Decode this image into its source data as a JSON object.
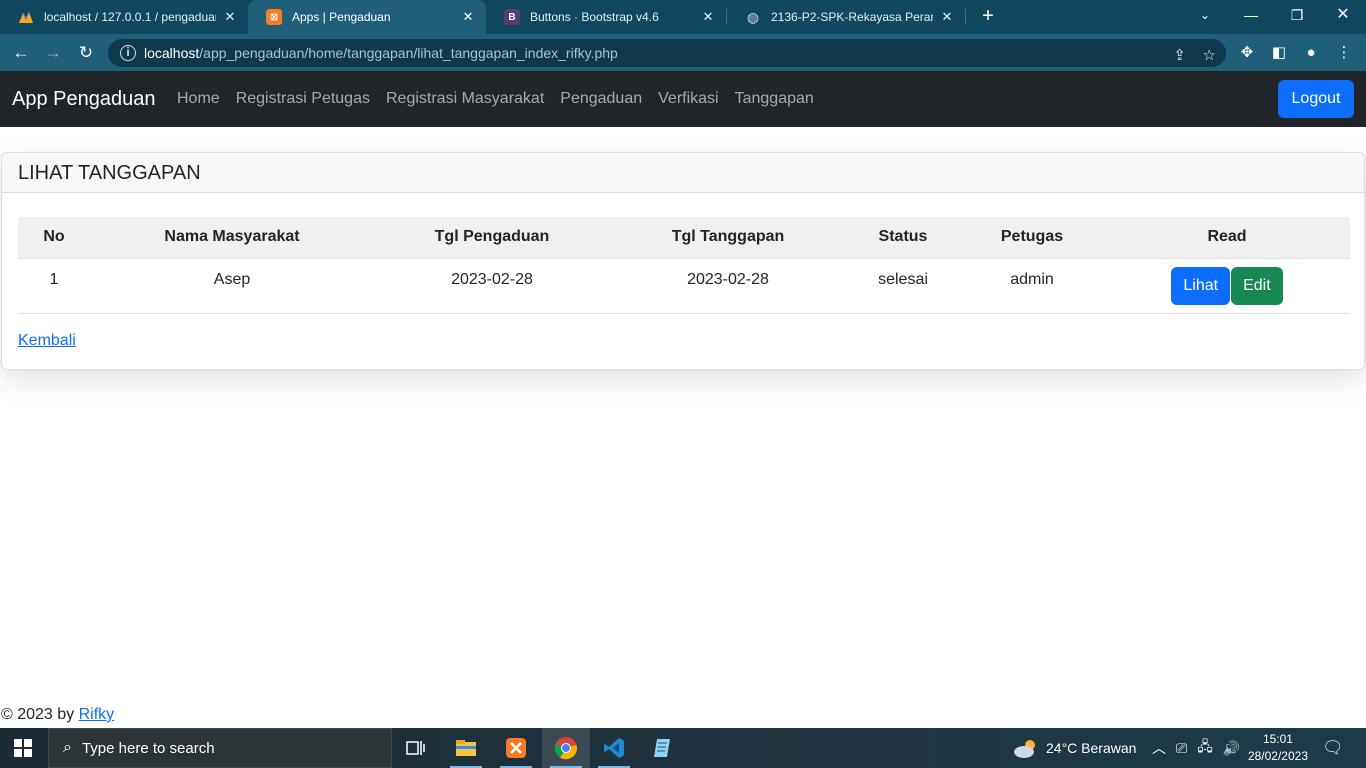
{
  "browser": {
    "tabs": [
      {
        "title": "localhost / 127.0.0.1 / pengaduan",
        "favicon": "phpmyadmin-icon",
        "active": false
      },
      {
        "title": "Apps | Pengaduan",
        "favicon": "xampp-icon",
        "active": true
      },
      {
        "title": "Buttons · Bootstrap v4.6",
        "favicon": "bootstrap-icon",
        "active": false
      },
      {
        "title": "2136-P2-SPK-Rekayasa Perangkat",
        "favicon": "globe-icon",
        "active": false
      }
    ],
    "url_host": "localhost",
    "url_path": "/app_pengaduan/home/tanggapan/lihat_tanggapan_index_rifky.php"
  },
  "navbar": {
    "brand": "App Pengaduan",
    "links": [
      "Home",
      "Registrasi Petugas",
      "Registrasi Masyarakat",
      "Pengaduan",
      "Verfikasi",
      "Tanggapan"
    ],
    "logout_label": "Logout"
  },
  "card": {
    "title": "LIHAT TANGGAPAN",
    "table": {
      "headers": [
        "No",
        "Nama Masyarakat",
        "Tgl Pengaduan",
        "Tgl Tanggapan",
        "Status",
        "Petugas",
        "Read"
      ],
      "rows": [
        {
          "no": "1",
          "nama": "Asep",
          "tgl_pengaduan": "2023-02-28",
          "tgl_tanggapan": "2023-02-28",
          "status": "selesai",
          "petugas": "admin",
          "lihat_label": "Lihat",
          "edit_label": "Edit"
        }
      ]
    },
    "back_link": "Kembali"
  },
  "footer": {
    "text": "© 2023 by",
    "author": "Rifky"
  },
  "taskbar": {
    "search_placeholder": "Type here to search",
    "weather": "24°C  Berawan",
    "time": "15:01",
    "date": "28/02/2023"
  },
  "colors": {
    "primary": "#0d6efd",
    "success": "#198754",
    "navbar_bg": "#212529",
    "browser_frame": "#10485e"
  }
}
